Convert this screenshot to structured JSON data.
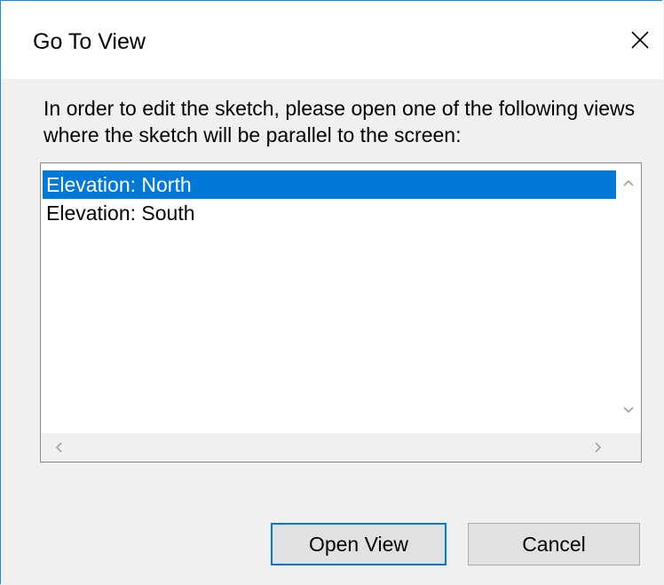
{
  "dialog": {
    "title": "Go To View",
    "close_icon": "close-icon",
    "message": "In order to edit the sketch, please open one of the following views where the sketch will be parallel to the screen:",
    "views": [
      {
        "label": "Elevation: North",
        "selected": true
      },
      {
        "label": "Elevation: South",
        "selected": false
      }
    ],
    "buttons": {
      "open_view": "Open View",
      "cancel": "Cancel"
    }
  },
  "colors": {
    "accent": "#0078d7",
    "selection_bg": "#0078d7",
    "border": "#1e88e5"
  }
}
